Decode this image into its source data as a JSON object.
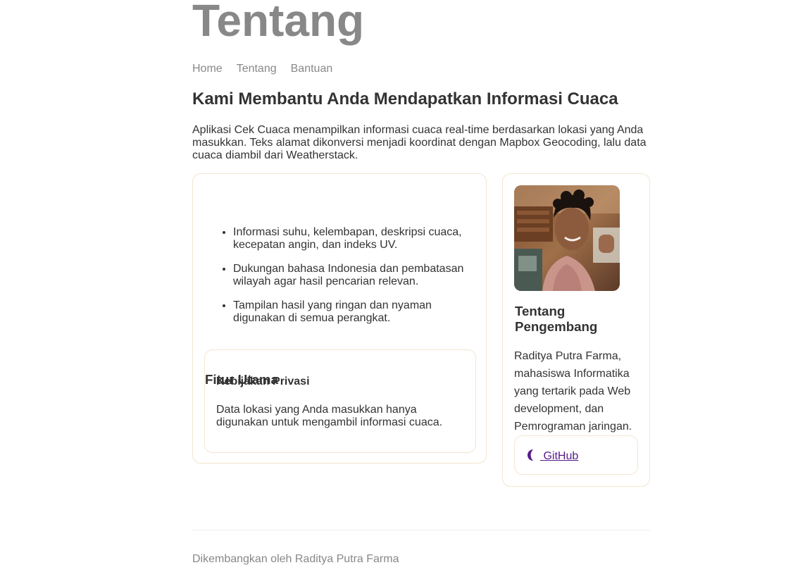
{
  "header": {
    "title": "Tentang",
    "nav": [
      "Home",
      "Tentang",
      "Bantuan"
    ]
  },
  "main": {
    "headline": "Kami Membantu Anda Mendapatkan Informasi Cuaca",
    "intro": "Aplikasi Cek Cuaca menampilkan informasi cuaca real-time berdasarkan lokasi yang Anda masukkan. Teks alamat dikonversi menjadi koordinat dengan Mapbox Geocoding, lalu data cuaca diambil dari Weatherstack.",
    "features": {
      "title": "Fitur Utama",
      "items": [
        "Informasi suhu, kelembapan, deskripsi cuaca, kecepatan angin, dan indeks UV.",
        "Dukungan bahasa Indonesia dan pembatasan wilayah agar hasil pencarian relevan.",
        "Tampilan hasil yang ringan dan nyaman digunakan di semua perangkat."
      ]
    },
    "privacy": {
      "title": "Kebijakan Privasi",
      "text": "Data lokasi yang Anda masukkan hanya digunakan untuk mengambil informasi cuaca."
    },
    "developer": {
      "title": "Tentang Pengembang",
      "bio": "Raditya Putra Farma, mahasiswa Informatika yang tertarik pada Web development, dan Pemrograman jaringan.",
      "github_label": " GitHub",
      "github_icon": "github-icon"
    }
  },
  "footer": {
    "text": "Dikembangkan oleh Raditya Putra Farma"
  },
  "colors": {
    "title_gray": "#888888",
    "text": "#333333",
    "card_border": "#f2e6cf",
    "link": "#551a8b"
  }
}
